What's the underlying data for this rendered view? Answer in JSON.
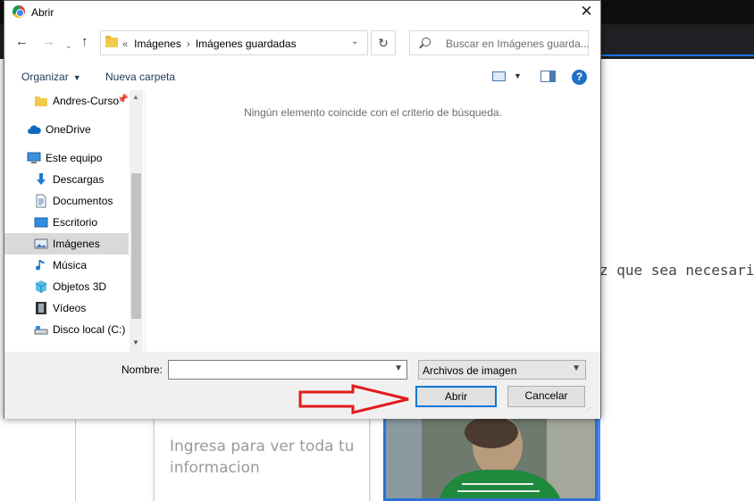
{
  "background": {
    "side_text": "z que sea necesari",
    "card_text": "Ingresa para ver toda tu informacion"
  },
  "dialog": {
    "title": "Abrir",
    "close_symbol": "✕",
    "nav": {
      "back": "←",
      "forward": "→",
      "recent": "⌄",
      "up": "↑",
      "refresh": "↻"
    },
    "address": {
      "overflow": "«",
      "crumbs": [
        "Imágenes",
        "Imágenes guardadas"
      ],
      "separator": "›",
      "dropdown": "⌄"
    },
    "search_placeholder": "Buscar en Imágenes guarda...",
    "toolbar": {
      "organize": "Organizar",
      "new_folder": "Nueva carpeta",
      "help": "?"
    },
    "tree": [
      {
        "label": "Andres-Curso",
        "icon": "folder-icon",
        "pinned": true
      },
      {
        "label": "OneDrive",
        "icon": "cloud-icon"
      },
      {
        "label": "Este equipo",
        "icon": "computer-icon"
      },
      {
        "label": "Descargas",
        "icon": "download-icon"
      },
      {
        "label": "Documentos",
        "icon": "document-icon"
      },
      {
        "label": "Escritorio",
        "icon": "desktop-icon"
      },
      {
        "label": "Imágenes",
        "icon": "pictures-icon",
        "selected": true
      },
      {
        "label": "Música",
        "icon": "music-icon"
      },
      {
        "label": "Objetos 3D",
        "icon": "cube-icon"
      },
      {
        "label": "Vídeos",
        "icon": "film-icon"
      },
      {
        "label": "Disco local (C:)",
        "icon": "drive-icon"
      }
    ],
    "empty_message": "Ningún elemento coincide con el criterio de búsqueda.",
    "bottom": {
      "name_label": "Nombre:",
      "name_value": "",
      "file_type": "Archivos de imagen",
      "open_button": "Abrir",
      "cancel_button": "Cancelar"
    }
  },
  "colors": {
    "accent": "#0078d7",
    "arrow": "#e21b1b",
    "selection": "#d9d9d9"
  }
}
